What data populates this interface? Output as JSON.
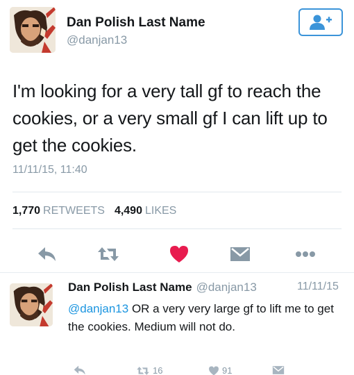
{
  "tweet": {
    "display_name": "Dan Polish Last Name",
    "handle": "@danjan13",
    "text": "I'm looking for a very tall gf to reach the cookies, or a very small gf I can lift up to get the cookies.",
    "timestamp": "11/11/15, 11:40",
    "retweets_count": "1,770",
    "retweets_label": "RETWEETS",
    "likes_count": "4,490",
    "likes_label": "LIKES",
    "liked": true
  },
  "reply": {
    "display_name": "Dan Polish Last Name",
    "handle": "@danjan13",
    "date": "11/11/15",
    "mention": "@danjan13",
    "text": " OR a very very large gf to lift me to get the cookies. Medium will not do.",
    "retweets_count": "16",
    "likes_count": "91"
  },
  "icons": [
    "follow-icon",
    "reply-icon",
    "retweet-icon",
    "heart-icon",
    "dm-icon",
    "more-icon"
  ],
  "colors": {
    "accent": "#3b94d9",
    "like": "#e81c4f",
    "muted": "#8899a6",
    "mention": "#1b95e0"
  }
}
